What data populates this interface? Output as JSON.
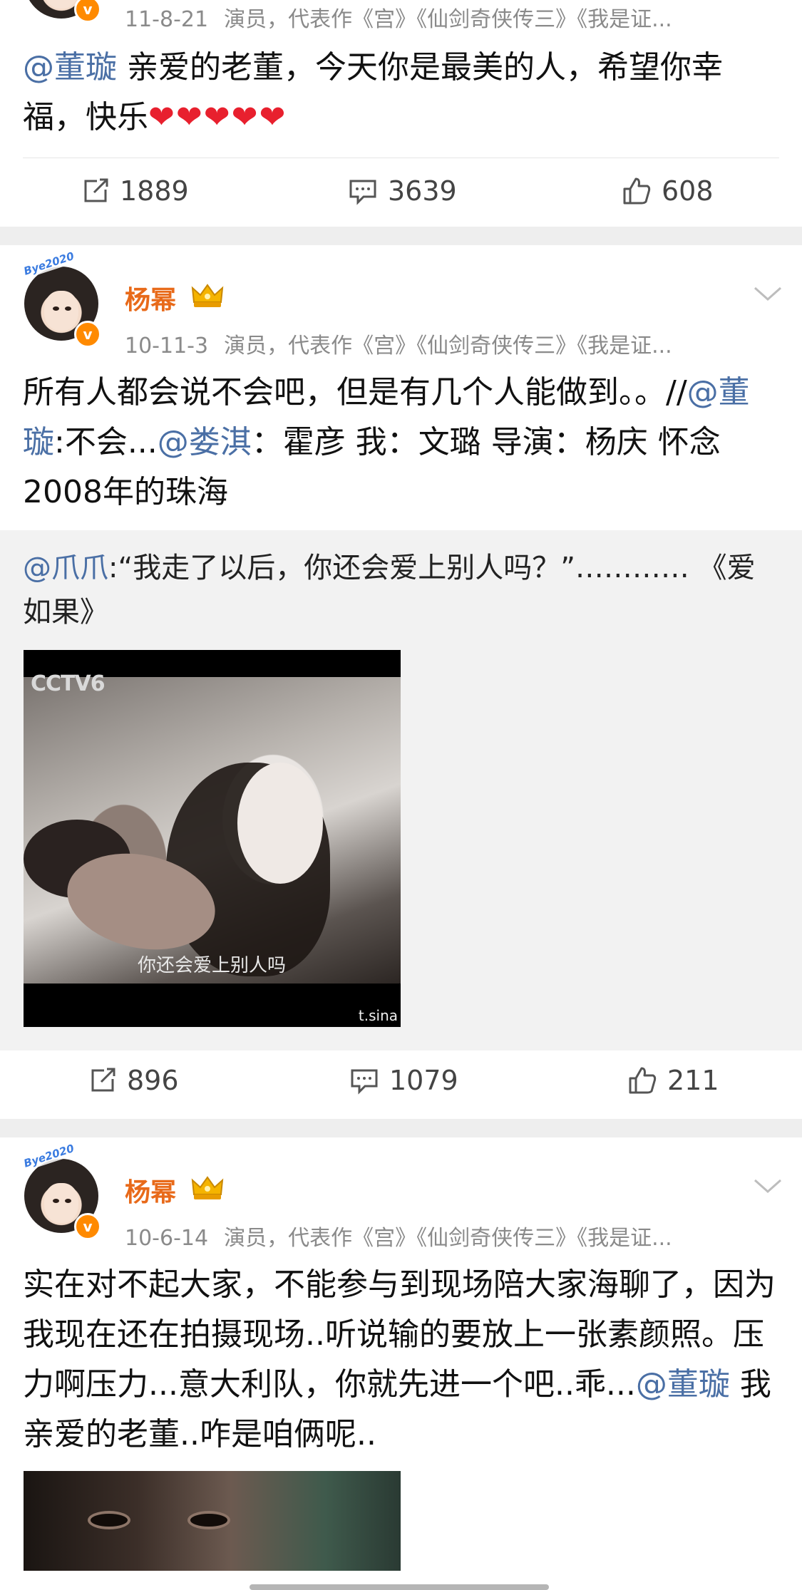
{
  "posts": [
    {
      "meta_date": "11-8-21",
      "meta_desc": "演员，代表作《宫》《仙剑奇侠传三》《我是证...",
      "mention": "@董璇",
      "text": " 亲爱的老董，今天你是最美的人，希望你幸福，快乐",
      "hearts": "❤❤❤❤❤",
      "reposts": "1889",
      "comments": "3639",
      "likes": "608"
    },
    {
      "name": "杨幂",
      "meta_date": "10-11-3",
      "meta_desc": "演员，代表作《宫》《仙剑奇侠传三》《我是证...",
      "text_a": "所有人都会说不会吧，但是有几个人能做到。。//",
      "mention_a": "@董璇",
      "text_b": ":不会...",
      "mention_b": "@娄淇",
      "text_c": "：霍彦 我：文璐 导演：杨庆 怀念2008年的珠海",
      "repost_mention": "@爪爪",
      "repost_text": ":“我走了以后，你还会爱上别人吗？”………… 《爱 如果》",
      "media_caption": "你还会爱上别人吗",
      "media_logo": "CCTV6",
      "media_watermark": "t.sina",
      "reposts": "896",
      "comments": "1079",
      "likes": "211"
    },
    {
      "name": "杨幂",
      "meta_date": "10-6-14",
      "meta_desc": "演员，代表作《宫》《仙剑奇侠传三》《我是证...",
      "text_a": "实在对不起大家，不能参与到现场陪大家海聊了，因为我现在还在拍摄现场..听说输的要放上一张素颜照。压力啊压力...意大利队，你就先进一个吧..乖...",
      "mention_a": "@董璇",
      "text_b": " 我亲爱的老董..咋是咱俩呢.."
    }
  ],
  "avatar_tag": "Bye2020",
  "verified_glyph": "v",
  "icons": {
    "repost": "repost-icon",
    "comment": "comment-icon",
    "like": "thumbs-up-icon",
    "crown": "crown-badge-icon",
    "chevron": "chevron-down-icon"
  },
  "colors": {
    "name": "#e86a1a",
    "link": "#4a6fa5",
    "meta": "#8a8a8a",
    "heart": "#e8202e",
    "repost_bg": "#f2f2f2"
  }
}
